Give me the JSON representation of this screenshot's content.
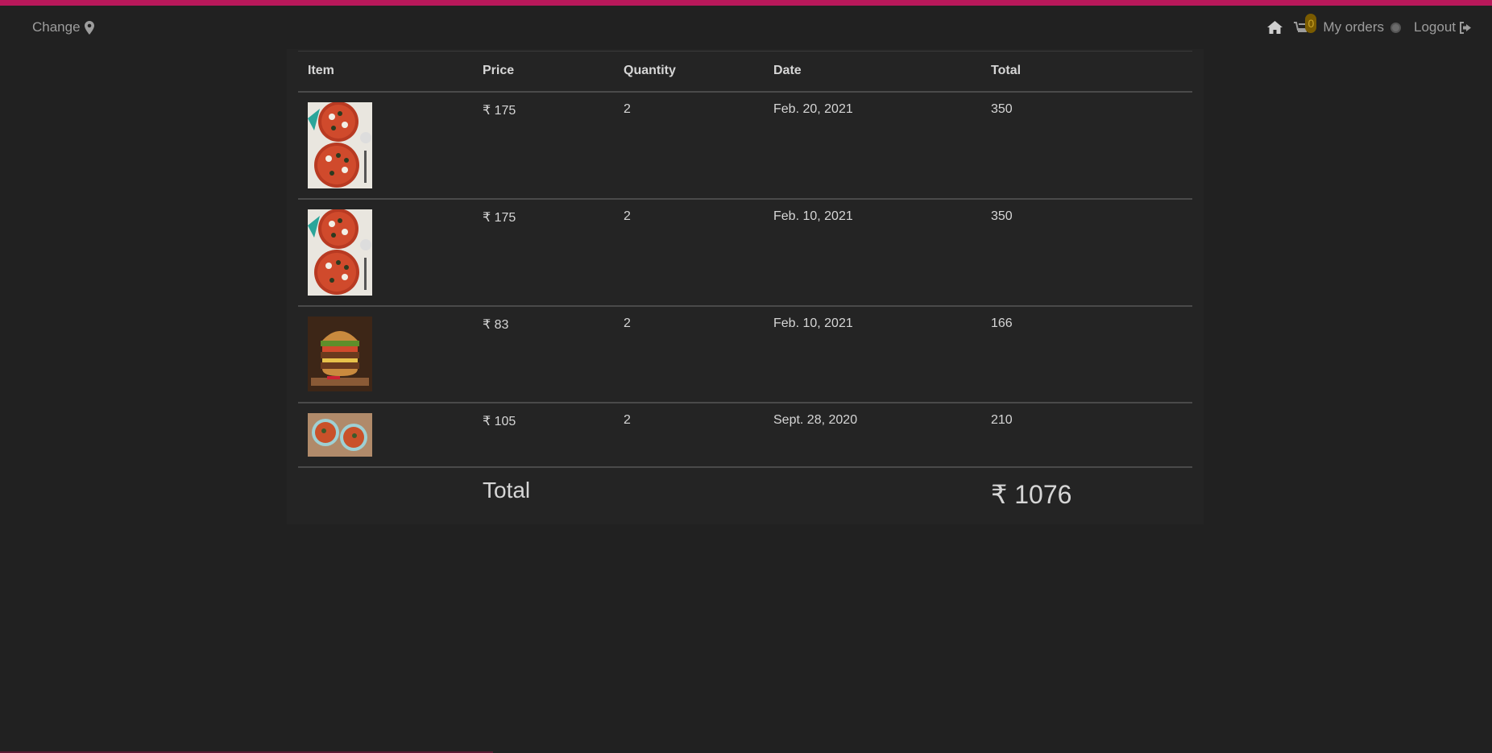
{
  "nav": {
    "change_label": "Change",
    "cart_count": "0",
    "orders_label": "My orders",
    "logout_label": "Logout"
  },
  "table": {
    "headers": [
      "Item",
      "Price",
      "Quantity",
      "Date",
      "Total"
    ],
    "rows": [
      {
        "item_icon": "pizza-image",
        "price": "₹ 175",
        "quantity": "2",
        "date": "Feb. 20, 2021",
        "total": "350"
      },
      {
        "item_icon": "pizza-image",
        "price": "₹ 175",
        "quantity": "2",
        "date": "Feb. 10, 2021",
        "total": "350"
      },
      {
        "item_icon": "burger-image",
        "price": "₹ 83",
        "quantity": "2",
        "date": "Feb. 10, 2021",
        "total": "166"
      },
      {
        "item_icon": "soup-image",
        "price": "₹ 105",
        "quantity": "2",
        "date": "Sept. 28, 2020",
        "total": "210"
      }
    ],
    "total_label": "Total",
    "total_value": "₹ 1076"
  },
  "colors": {
    "accent": "#b8185a",
    "background": "#212121",
    "badge": "#7a5b00"
  }
}
